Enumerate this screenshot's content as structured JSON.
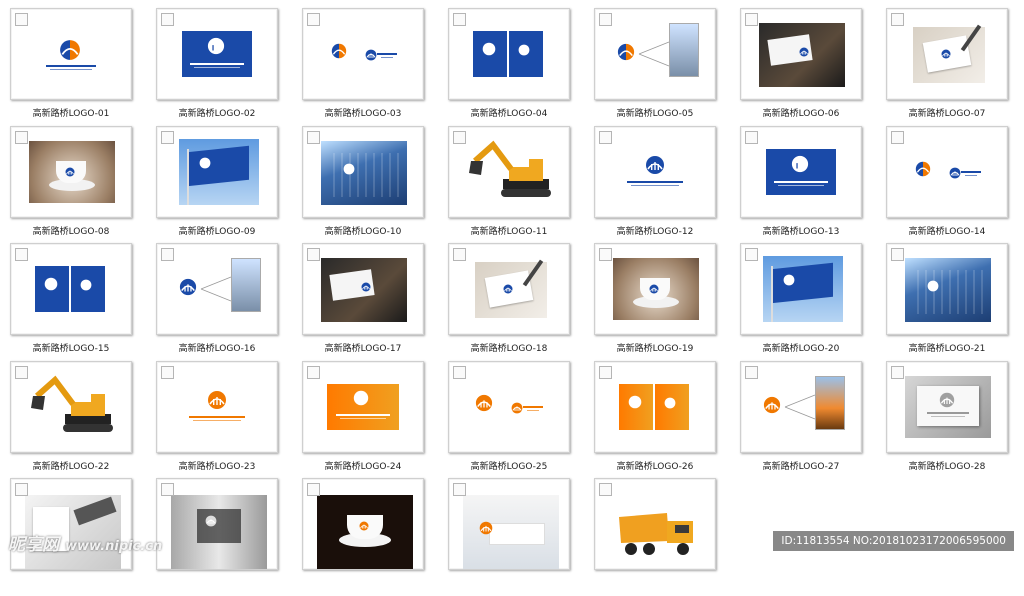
{
  "thumbnails": [
    {
      "caption": "高新路桥LOGO-01",
      "art": "logo-white"
    },
    {
      "caption": "高新路桥LOGO-02",
      "art": "logo-blue-card"
    },
    {
      "caption": "高新路桥LOGO-03",
      "art": "logo-pair-white"
    },
    {
      "caption": "高新路桥LOGO-04",
      "art": "blue-cards-pair"
    },
    {
      "caption": "高新路桥LOGO-05",
      "art": "logo-explain-orange"
    },
    {
      "caption": "高新路桥LOGO-06",
      "art": "business-card-dark"
    },
    {
      "caption": "高新路桥LOGO-07",
      "art": "paper-hand"
    },
    {
      "caption": "高新路桥LOGO-08",
      "art": "coffee-cup"
    },
    {
      "caption": "高新路桥LOGO-09",
      "art": "flag-blue"
    },
    {
      "caption": "高新路桥LOGO-10",
      "art": "building-glass"
    },
    {
      "caption": "高新路桥LOGO-11",
      "art": "excavator"
    },
    {
      "caption": "高新路桥LOGO-12",
      "art": "logo-white-blue"
    },
    {
      "caption": "高新路桥LOGO-13",
      "art": "logo-blue-card"
    },
    {
      "caption": "高新路桥LOGO-14",
      "art": "logo-pair-white"
    },
    {
      "caption": "高新路桥LOGO-15",
      "art": "blue-cards-pair"
    },
    {
      "caption": "高新路桥LOGO-16",
      "art": "logo-explain-blue"
    },
    {
      "caption": "高新路桥LOGO-17",
      "art": "business-card-dark"
    },
    {
      "caption": "高新路桥LOGO-18",
      "art": "paper-hand"
    },
    {
      "caption": "高新路桥LOGO-19",
      "art": "coffee-cup"
    },
    {
      "caption": "高新路桥LOGO-20",
      "art": "flag-blue"
    },
    {
      "caption": "高新路桥LOGO-21",
      "art": "building-glass"
    },
    {
      "caption": "高新路桥LOGO-22",
      "art": "excavator"
    },
    {
      "caption": "高新路桥LOGO-23",
      "art": "logo-orange-white"
    },
    {
      "caption": "高新路桥LOGO-24",
      "art": "orange-card"
    },
    {
      "caption": "高新路桥LOGO-25",
      "art": "orange-pair-white"
    },
    {
      "caption": "高新路桥LOGO-26",
      "art": "orange-cards-pair"
    },
    {
      "caption": "高新路桥LOGO-27",
      "art": "orange-explain"
    },
    {
      "caption": "高新路桥LOGO-28",
      "art": "grey-paper"
    },
    {
      "caption": "",
      "art": "stationery"
    },
    {
      "caption": "",
      "art": "glass-sign"
    },
    {
      "caption": "",
      "art": "coffee-dark"
    },
    {
      "caption": "",
      "art": "office-interior"
    },
    {
      "caption": "",
      "art": "dump-truck"
    }
  ],
  "watermark": {
    "brand": "昵享网",
    "site": "www.nipic.cn"
  },
  "id_bar": "ID:11813554 NO:20181023172006595000",
  "colors": {
    "brand_blue": "#1a4aa8",
    "brand_orange": "#f07800",
    "caption_text": "#222222"
  }
}
